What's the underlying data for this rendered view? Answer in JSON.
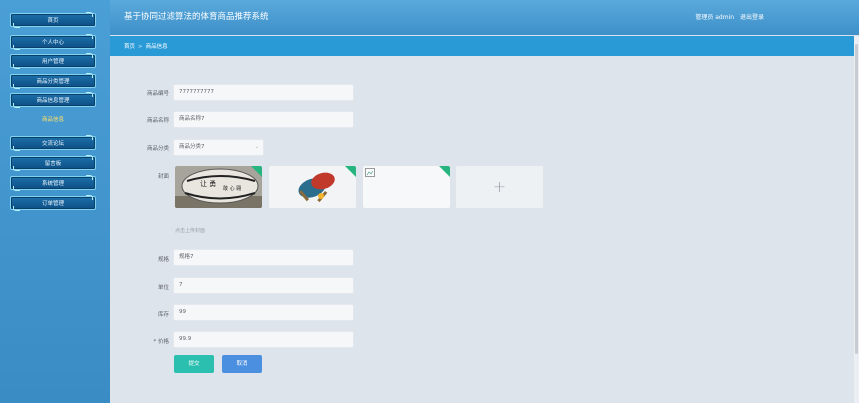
{
  "app": {
    "title": "基于协同过滤算法的体育商品推荐系统",
    "user": "管理员 admin",
    "logout": "退出登录"
  },
  "sidebar": {
    "items": [
      {
        "label": "首页"
      },
      {
        "label": "个人中心"
      },
      {
        "label": "用户管理"
      },
      {
        "label": "商品分类管理"
      },
      {
        "label": "商品信息管理"
      },
      {
        "label": "商品信息",
        "active": true
      },
      {
        "label": "交流论坛"
      },
      {
        "label": "留言板"
      },
      {
        "label": "系统管理"
      },
      {
        "label": "订单管理"
      }
    ]
  },
  "breadcrumb": {
    "home": "首页",
    "sep": ">",
    "current": "商品信息"
  },
  "form": {
    "code": {
      "label": "商品编号",
      "value": "7777777777"
    },
    "name": {
      "label": "商品名称",
      "value": "商品名称7"
    },
    "category": {
      "label": "商品分类",
      "value": "商品分类7"
    },
    "cover": {
      "label": "封面",
      "hint": "点击上传封面"
    },
    "spec": {
      "label": "规格",
      "value": "规格7"
    },
    "unit": {
      "label": "单位",
      "value": "7"
    },
    "stock": {
      "label": "库存",
      "value": "99"
    },
    "price": {
      "label": "* 价格",
      "value": "99.9"
    }
  },
  "buttons": {
    "submit": "提交",
    "cancel": "取消"
  },
  "colors": {
    "accent": "#2a9ad7",
    "submit": "#2bbfb0",
    "cancel": "#4b8fe0",
    "corner": "#26b57f"
  }
}
